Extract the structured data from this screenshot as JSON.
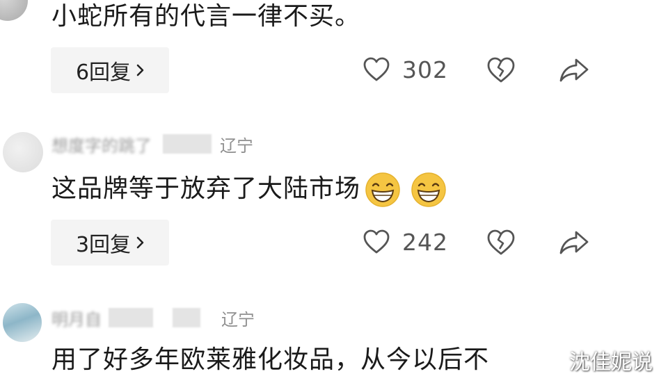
{
  "comments": [
    {
      "username": "",
      "region": "",
      "text": "小蛇所有的代言一律不买。",
      "replies_label": "6回复",
      "likes": "302"
    },
    {
      "username": "想度字的跳了",
      "region": "辽宁",
      "text": "这品牌等于放弃了大陆市场",
      "replies_label": "3回复",
      "likes": "242"
    },
    {
      "username": "明月自",
      "region": "辽宁",
      "text": "用了好多年欧莱雅化妆品，从今以后不"
    }
  ],
  "watermark": "沈佳妮说",
  "colors": {
    "background": "#ffffff",
    "chip_background": "#f4f4f4",
    "text": "#1a1a1a",
    "muted": "#8f8f8f",
    "icon": "#555555",
    "emoji": "#f5c542"
  },
  "icons": [
    "heart-icon",
    "broken-heart-icon",
    "share-arrow-icon",
    "chevron-right-icon",
    "grinning-emoji-icon"
  ]
}
